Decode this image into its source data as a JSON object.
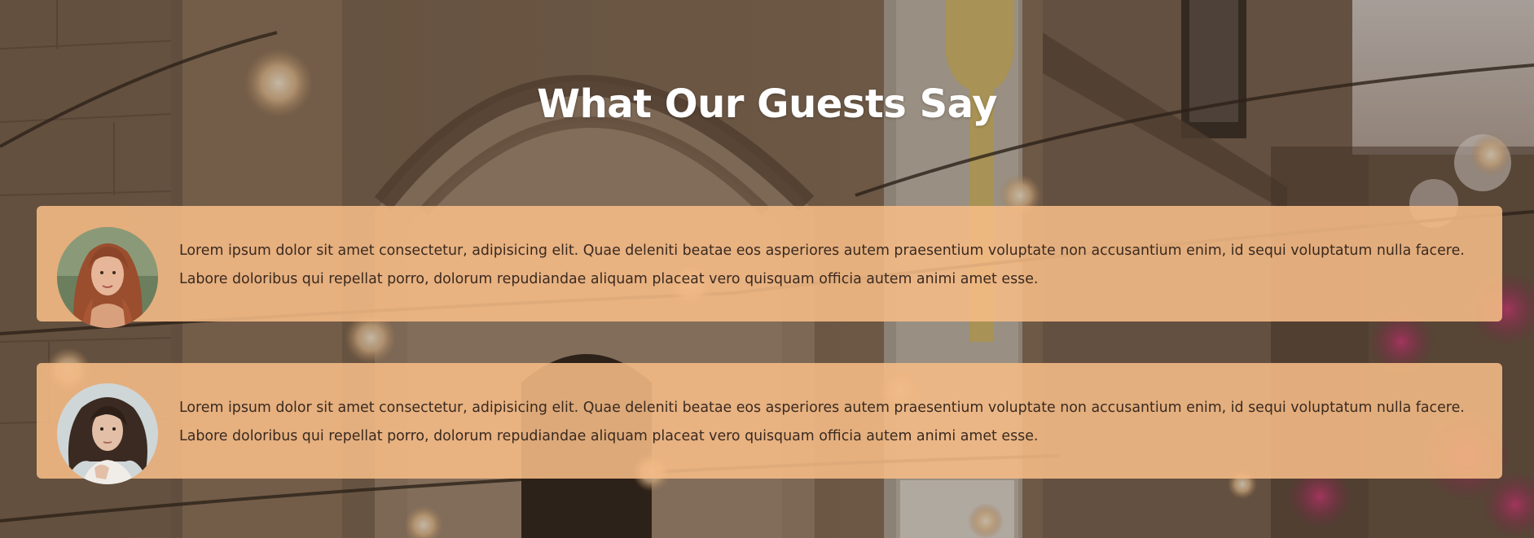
{
  "section": {
    "title": "What Our Guests Say"
  },
  "testimonials": [
    {
      "avatar_icon": "woman-redhead-avatar-icon",
      "text": "Lorem ipsum dolor sit amet consectetur, adipisicing elit. Quae deleniti beatae eos asperiores autem praesentium voluptate non accusantium enim, id sequi voluptatum nulla facere. Labore doloribus qui repellat porro, dolorum repudiandae aliquam placeat vero quisquam officia autem animi amet esse."
    },
    {
      "avatar_icon": "woman-curly-hair-avatar-icon",
      "text": "Lorem ipsum dolor sit amet consectetur, adipisicing elit. Quae deleniti beatae eos asperiores autem praesentium voluptate non accusantium enim, id sequi voluptatum nulla facere. Labore doloribus qui repellat porro, dolorum repudiandae aliquam placeat vero quisquam officia autem animi amet esse."
    }
  ],
  "colors": {
    "card_background": "#f6bc86",
    "title_text": "#ffffff",
    "body_text": "#3a2a20"
  }
}
